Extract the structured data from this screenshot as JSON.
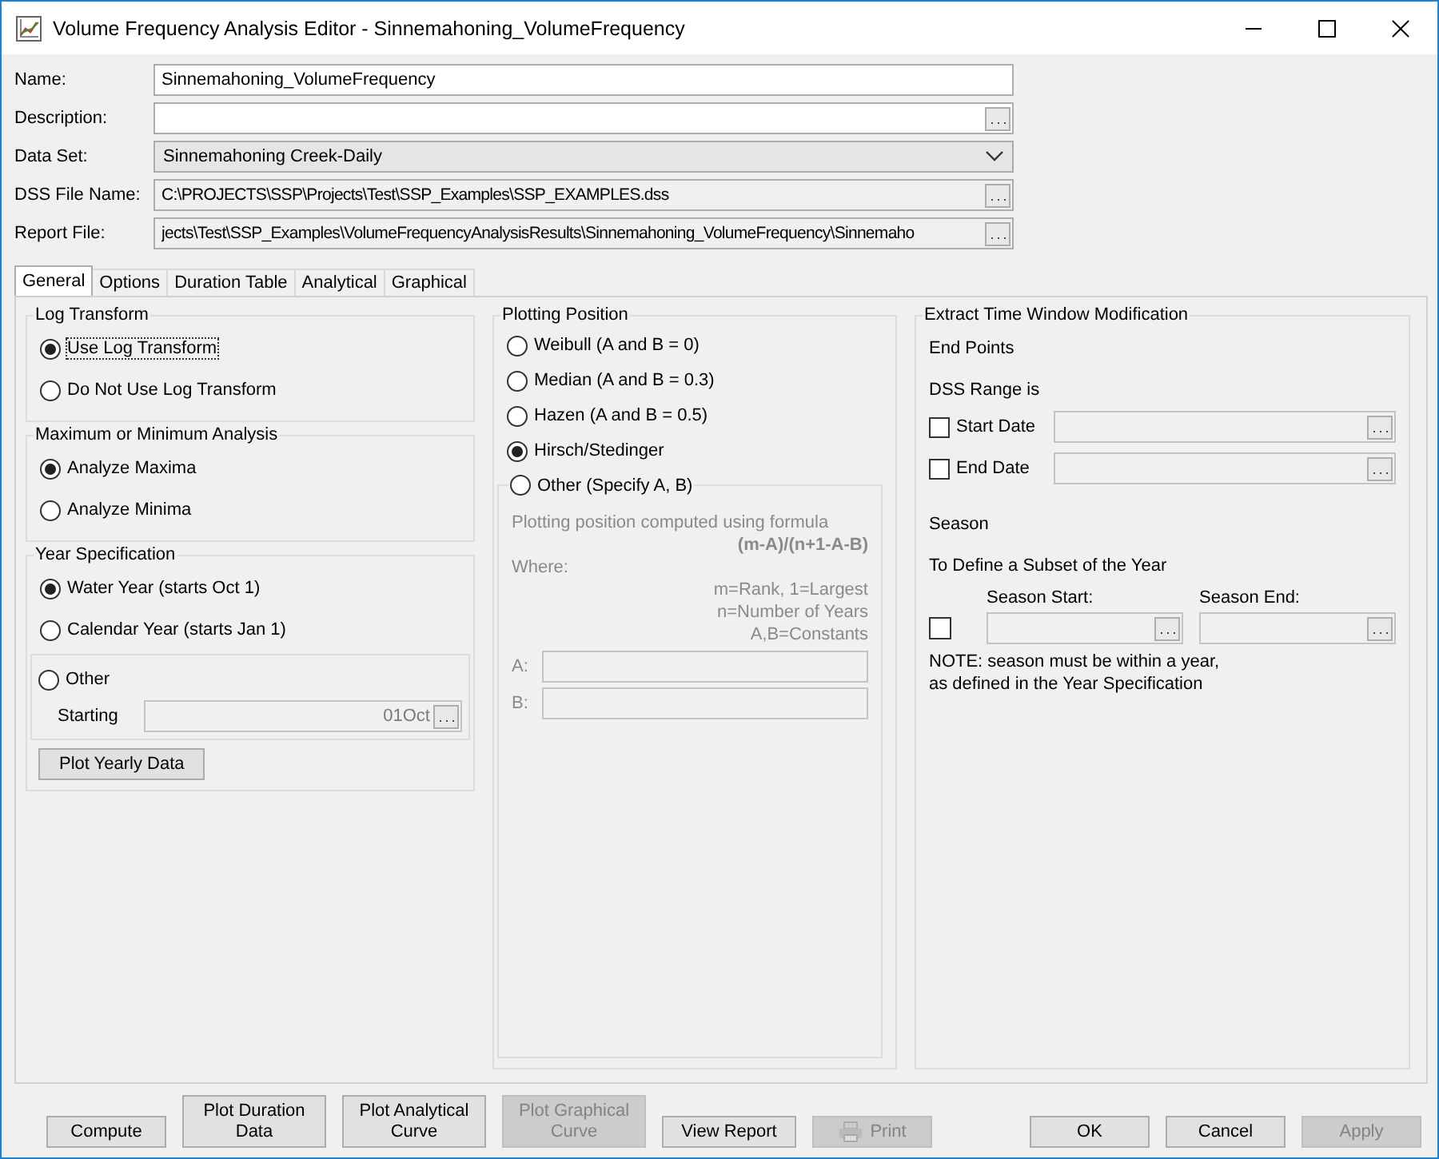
{
  "window": {
    "title": "Volume Frequency Analysis Editor - Sinnemahoning_VolumeFrequency"
  },
  "fields": [
    {
      "label": "Name:",
      "kind": "text",
      "value": "Sinnemahoning_VolumeFrequency"
    },
    {
      "label": "Description:",
      "kind": "browse"
    },
    {
      "label": "Data Set:",
      "kind": "dropdown",
      "value": "Sinnemahoning Creek-Daily"
    },
    {
      "label": "DSS File Name:",
      "kind": "browse",
      "value": "C:\\PROJECTS\\SSP\\Projects\\Test\\SSP_Examples\\SSP_EXAMPLES.dss"
    },
    {
      "label": "Report File:",
      "kind": "browse",
      "value": "jects\\Test\\SSP_Examples\\VolumeFrequencyAnalysisResults\\Sinnemahoning_VolumeFrequency\\Sinnemaho"
    }
  ],
  "tabs": [
    {
      "label": "General",
      "selected": true
    },
    {
      "label": "Options",
      "selected": false
    },
    {
      "label": "Duration Table",
      "selected": false
    },
    {
      "label": "Analytical",
      "selected": false
    },
    {
      "label": "Graphical",
      "selected": false
    }
  ],
  "log_transform": {
    "title": "Log Transform",
    "options": [
      {
        "label": "Use Log Transform",
        "selected": true,
        "focused": true
      },
      {
        "label": "Do Not Use Log Transform",
        "selected": false,
        "focused": false
      }
    ]
  },
  "analysis": {
    "title": "Maximum or Minimum Analysis",
    "options": [
      {
        "label": "Analyze Maxima",
        "selected": true
      },
      {
        "label": "Analyze Minima",
        "selected": false
      }
    ]
  },
  "year_specification": {
    "title": "Year Specification",
    "options": [
      {
        "label": "Water Year (starts Oct 1)",
        "selected": true
      },
      {
        "label": "Calendar Year (starts Jan 1)",
        "selected": false
      }
    ],
    "other": {
      "label": "Other",
      "selected": false
    },
    "starting": {
      "label": "Starting",
      "value": "01Oct",
      "disabled": true
    },
    "button": "Plot Yearly Data"
  },
  "plotting_position": {
    "title": "Plotting Position",
    "options": [
      {
        "label": "Weibull (A and B = 0)",
        "selected": false
      },
      {
        "label": "Median (A and B = 0.3)",
        "selected": false
      },
      {
        "label": "Hazen (A and B = 0.5)",
        "selected": false
      },
      {
        "label": "Hirsch/Stedinger",
        "selected": true
      }
    ],
    "other": {
      "label": "Other (Specify A, B)",
      "selected": false,
      "disabled": true
    },
    "formula_lines": [
      {
        "kind": "caption",
        "text": "Plotting position computed using formula"
      },
      {
        "kind": "formula",
        "text": "(m-A)/(n+1-A-B)"
      },
      {
        "kind": "caption",
        "text": "Where:"
      },
      {
        "kind": "definition",
        "text": "m=Rank, 1=Largest"
      },
      {
        "kind": "definition",
        "text": "n=Number of Years"
      },
      {
        "kind": "definition",
        "text": "A,B=Constants"
      }
    ],
    "constants": [
      {
        "label": "A:"
      },
      {
        "label": "B:"
      }
    ]
  },
  "extract": {
    "title": "Extract Time Window Modification",
    "end_points": "End Points",
    "dss_range": "DSS Range is",
    "dates": [
      {
        "label": "Start Date",
        "checked": false
      },
      {
        "label": "End Date",
        "checked": false
      }
    ],
    "season": "Season",
    "subset": "To Define a Subset of the Year",
    "season_start": "Season Start:",
    "season_end": "Season End:",
    "season_checked": false,
    "note": [
      "NOTE: season must be within a year,",
      "as defined in the Year Specification"
    ]
  },
  "buttons": [
    {
      "label": "Compute",
      "kind": "text",
      "disabled": false
    },
    {
      "label": "Plot Duration Data",
      "kind": "text",
      "disabled": false
    },
    {
      "label": "Plot Analytical Curve",
      "kind": "text",
      "disabled": false
    },
    {
      "label": "Plot Graphical Curve",
      "kind": "text",
      "disabled": true
    },
    {
      "label": "View Report",
      "kind": "text",
      "disabled": false
    },
    {
      "label": "Print",
      "kind": "print",
      "disabled": true
    }
  ],
  "dialog_buttons": [
    {
      "label": "OK",
      "disabled": false
    },
    {
      "label": "Cancel",
      "disabled": false
    },
    {
      "label": "Apply",
      "disabled": true
    }
  ]
}
